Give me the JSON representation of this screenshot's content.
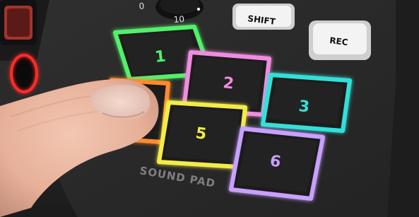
{
  "knob_labels": {
    "min": "0",
    "max": "10"
  },
  "buttons": {
    "shift_label": "SHIFT",
    "rec_label": "REC"
  },
  "pads": [
    {
      "label": "1",
      "color": "#53f06a"
    },
    {
      "label": "2",
      "color": "#f08ce0"
    },
    {
      "label": "3",
      "color": "#33e0d8"
    },
    {
      "label": "",
      "color": "#ff8a2e"
    },
    {
      "label": "5",
      "color": "#f3ec4a"
    },
    {
      "label": "6",
      "color": "#c9a0ff"
    }
  ],
  "section_label": "SOUND PAD"
}
